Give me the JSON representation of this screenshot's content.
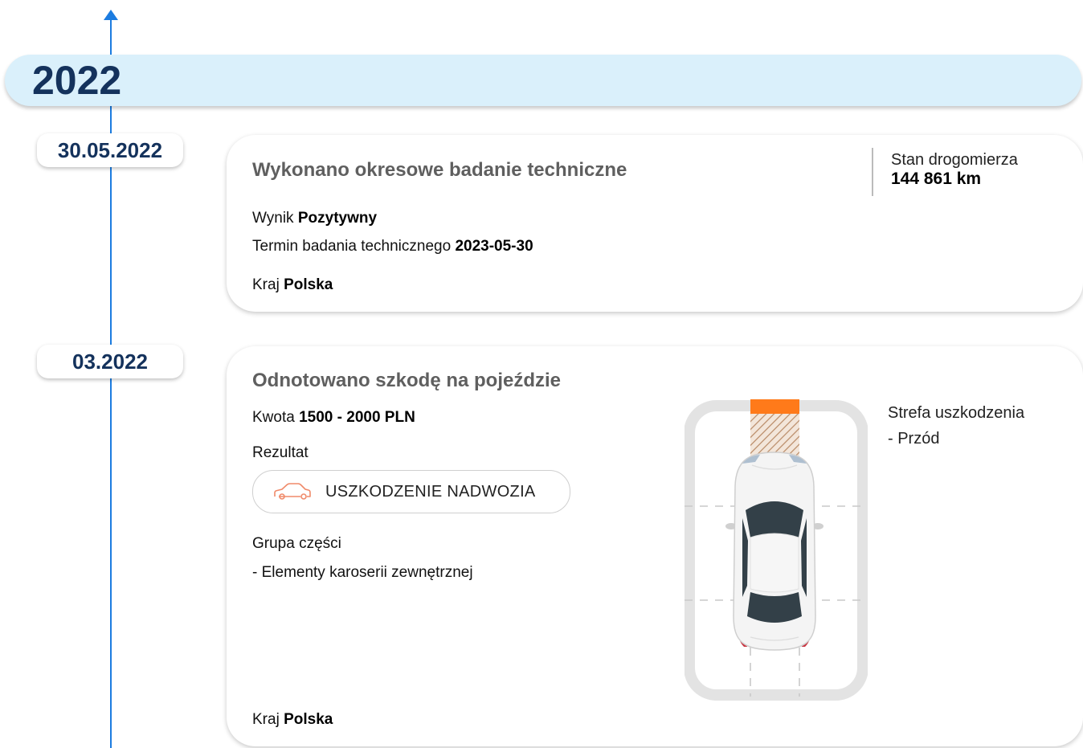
{
  "year": "2022",
  "events": [
    {
      "date": "30.05.2022",
      "title": "Wykonano okresowe badanie techniczne",
      "odometer_label": "Stan drogomierza",
      "odometer_value": "144 861 km",
      "result_label": "Wynik",
      "result_value": "Pozytywny",
      "deadline_label": "Termin badania technicznego",
      "deadline_value": "2023-05-30",
      "country_label": "Kraj",
      "country_value": "Polska"
    },
    {
      "date": "03.2022",
      "title": "Odnotowano szkodę na pojeździe",
      "amount_label": "Kwota",
      "amount_value": "1500 - 2000 PLN",
      "outcome_label": "Rezultat",
      "outcome_chip": "USZKODZENIE NADWOZIA",
      "outcome_icon": "car-damage-icon",
      "parts_label": "Grupa części",
      "parts_item": "- Elementy karoserii zewnętrznej",
      "zone_label": "Strefa uszkodzenia",
      "zone_item": "- Przód",
      "damaged_zone": "front",
      "damage_color": "#ff7a1a",
      "country_label": "Kraj",
      "country_value": "Polska"
    }
  ],
  "colors": {
    "timeline": "#1c7ce0",
    "year_bar": "#daf0fb",
    "date_text": "#14325c"
  }
}
